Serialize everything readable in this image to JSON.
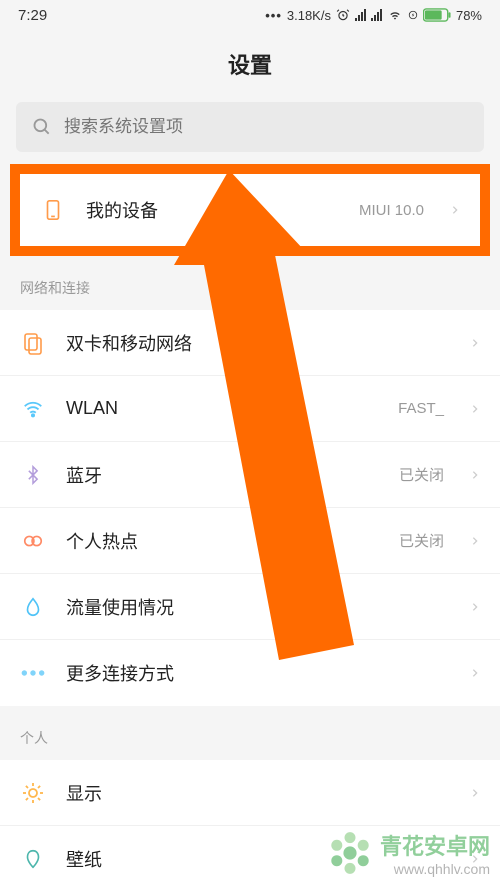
{
  "status_bar": {
    "time": "7:29",
    "data_speed": "3.18K/s",
    "battery": "78%"
  },
  "title": "设置",
  "search": {
    "placeholder": "搜索系统设置项"
  },
  "highlighted_item": {
    "label": "我的设备",
    "value": "MIUI 10.0"
  },
  "sections": [
    {
      "header": "网络和连接",
      "items": [
        {
          "icon": "sim-icon",
          "icon_color": "#ff9b4a",
          "label": "双卡和移动网络",
          "value": ""
        },
        {
          "icon": "wifi-icon",
          "icon_color": "#5ac8fa",
          "label": "WLAN",
          "value": "FAST_"
        },
        {
          "icon": "bluetooth-icon",
          "icon_color": "#b39ddb",
          "label": "蓝牙",
          "value": "已关闭"
        },
        {
          "icon": "hotspot-icon",
          "icon_color": "#ff8a65",
          "label": "个人热点",
          "value": "已关闭"
        },
        {
          "icon": "data-usage-icon",
          "icon_color": "#4fc3f7",
          "label": "流量使用情况",
          "value": ""
        },
        {
          "icon": "more-icon",
          "icon_color": "#81d4fa",
          "label": "更多连接方式",
          "value": ""
        }
      ]
    },
    {
      "header": "个人",
      "items": [
        {
          "icon": "display-icon",
          "icon_color": "#ffb74d",
          "label": "显示",
          "value": ""
        },
        {
          "icon": "wallpaper-icon",
          "icon_color": "#4db6ac",
          "label": "壁纸",
          "value": ""
        }
      ]
    }
  ],
  "watermark": {
    "title": "青花安卓网",
    "url": "www.qhhlv.com"
  }
}
